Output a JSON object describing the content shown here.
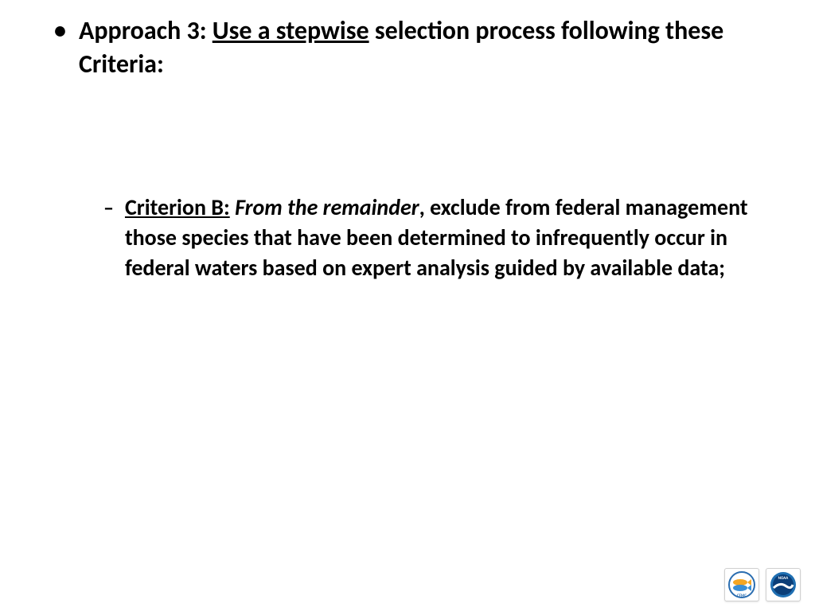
{
  "main_bullet": {
    "label_prefix": "Approach 3: ",
    "underlined": "Use a stepwise",
    "label_suffix": " selection process following these Criteria:"
  },
  "sub_bullet": {
    "label_underlined": "Criterion B:",
    "label_italic": " From the remainder",
    "label_rest": ", exclude from federal management those species that have been determined to infrequently occur in federal waters based on expert analysis guided by available data;"
  },
  "logos": {
    "left_name": "CFMC",
    "right_name": "NOAA"
  }
}
